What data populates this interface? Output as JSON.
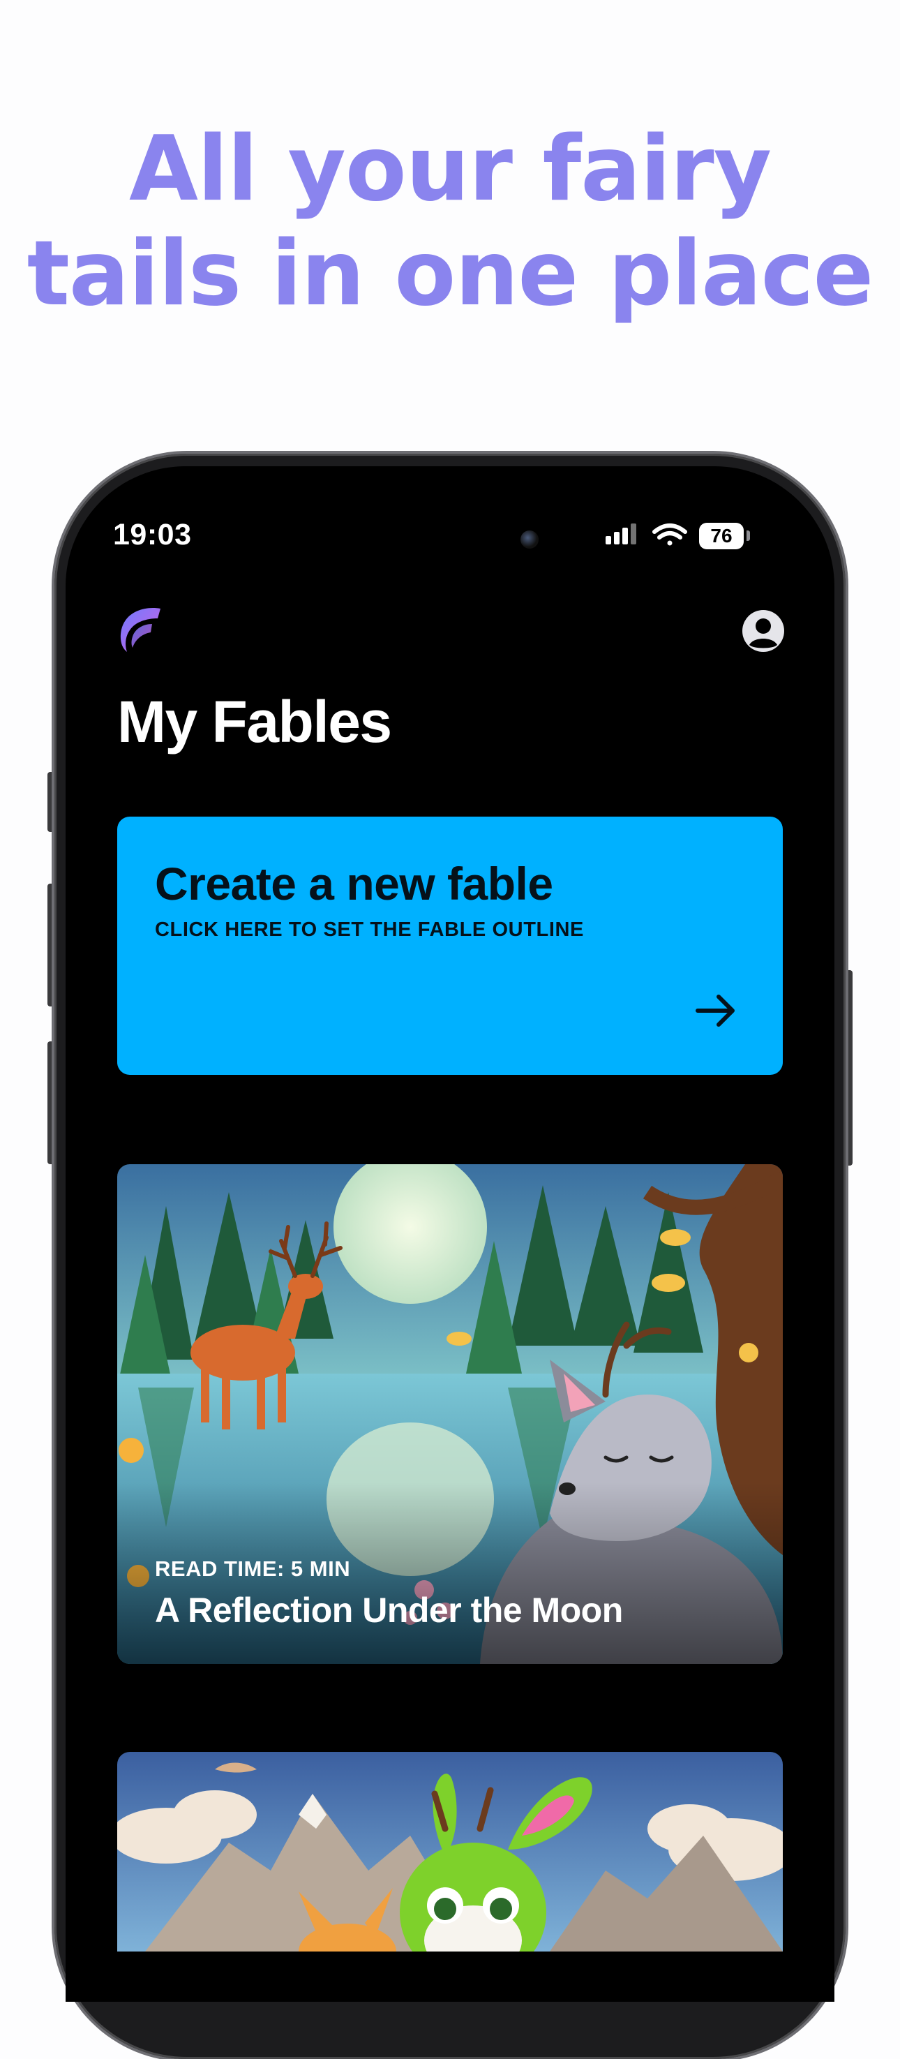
{
  "headline": {
    "line1": "All your fairy",
    "line2": "tails in one place"
  },
  "status_bar": {
    "time": "19:03",
    "battery": "76",
    "icons": [
      "signal-icon",
      "wifi-icon",
      "battery-icon"
    ]
  },
  "header": {
    "logo_icon": "fables-logo-icon",
    "profile_icon": "profile-icon"
  },
  "page": {
    "title": "My Fables"
  },
  "create_card": {
    "title": "Create a new fable",
    "subtitle": "CLICK HERE TO SET THE FABLE OUTLINE",
    "icon": "arrow-right-icon",
    "color": "#00b1ff"
  },
  "stories": [
    {
      "read_time": "READ TIME: 5 MIN",
      "title": "A Reflection Under the Moon"
    },
    {
      "read_time": "",
      "title": ""
    }
  ],
  "colors": {
    "headline": "#8a84ee",
    "background": "#fdfdfe",
    "screen": "#000000"
  }
}
